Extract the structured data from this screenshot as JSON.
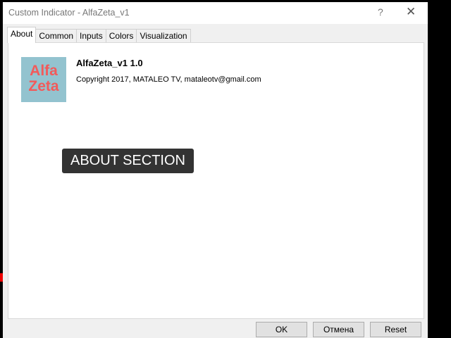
{
  "window": {
    "title": "Custom Indicator - AlfaZeta_v1",
    "help": "?",
    "close": "✕"
  },
  "tabs": [
    "About",
    "Common",
    "Inputs",
    "Colors",
    "Visualization"
  ],
  "about": {
    "logo_text": [
      "Alfa",
      "Zeta"
    ],
    "name": "AlfaZeta_v1 1.0",
    "copyright": "Copyright 2017, MATALEO TV, mataleotv@gmail.com",
    "overlay": "ABOUT SECTION"
  },
  "buttons": {
    "ok": "OK",
    "cancel": "Отмена",
    "reset": "Reset"
  }
}
